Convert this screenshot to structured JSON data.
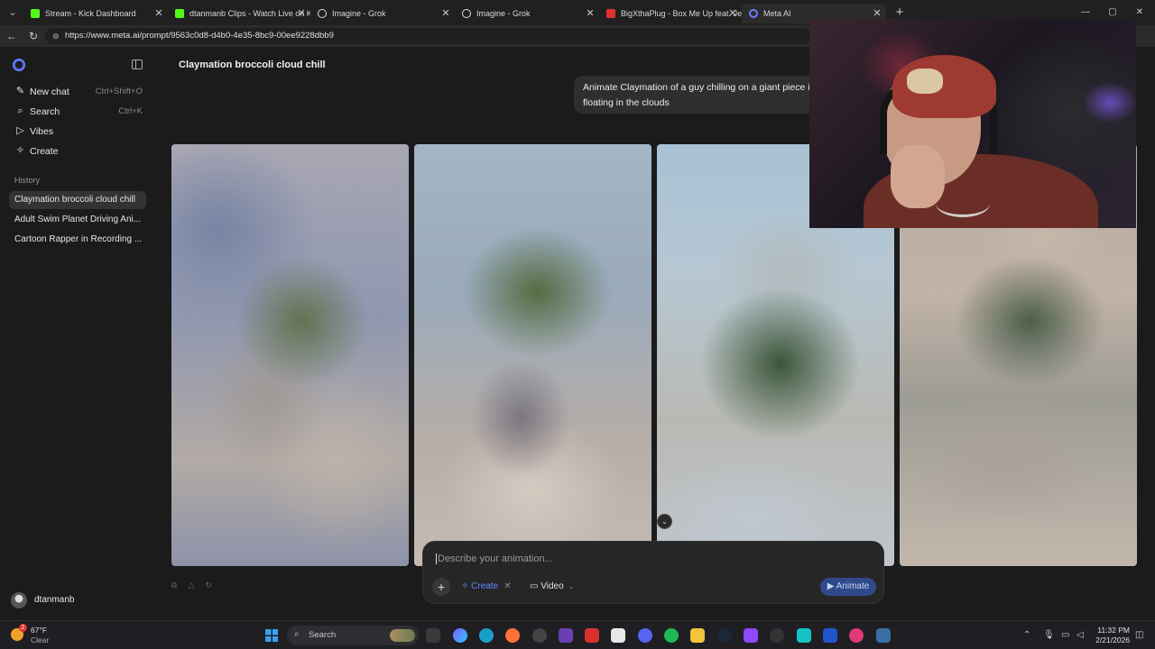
{
  "browser": {
    "tabs": [
      {
        "label": "Stream - Kick Dashboard",
        "icon": "kick-icon",
        "color": "#53fc18"
      },
      {
        "label": "dtanmanb Clips - Watch Live on K",
        "icon": "kick-icon",
        "color": "#53fc18"
      },
      {
        "label": "Imagine - Grok",
        "icon": "grok-icon",
        "color": "#ffffff"
      },
      {
        "label": "Imagine - Grok",
        "icon": "grok-icon",
        "color": "#ffffff"
      },
      {
        "label": "BigXthaPlug - Box Me Up feat. Jell",
        "icon": "youtube-icon",
        "color": "#e03030"
      },
      {
        "label": "Meta AI",
        "icon": "meta-ai-icon",
        "color": "#6d7cff"
      }
    ],
    "url": "https://www.meta.ai/prompt/9563c0d8-d4b0-4e35-8bc9-00ee9228dbb9"
  },
  "sidebar": {
    "nav": [
      {
        "label": "New chat",
        "shortcut": "Ctrl+Shift+O",
        "icon": "new-chat-icon"
      },
      {
        "label": "Search",
        "shortcut": "Ctrl+K",
        "icon": "search-icon"
      },
      {
        "label": "Vibes",
        "shortcut": "",
        "icon": "vibes-icon"
      },
      {
        "label": "Create",
        "shortcut": "",
        "icon": "create-icon"
      }
    ],
    "history_label": "History",
    "history": [
      "Claymation broccoli cloud chill",
      "Adult Swim Planet Driving Ani...",
      "Cartoon Rapper in Recording ..."
    ],
    "user": "dtanmanb"
  },
  "main": {
    "title": "Claymation broccoli cloud chill",
    "prompt": "Animate Claymation of a guy chilling on a giant piece if floating in the clouds",
    "composer": {
      "placeholder": "Describe your animation...",
      "create_label": "Create",
      "video_label": "Video",
      "animate_label": "Animate"
    }
  },
  "taskbar": {
    "weather_temp": "67°F",
    "weather_cond": "Clear",
    "weather_badge": "2",
    "search_label": "Search",
    "time": "11:32 PM",
    "date": "2/21/2026"
  },
  "colors": {
    "accent": "#5e8dff",
    "animate_button": "#2f4a8a",
    "background": "#1b1b1b"
  }
}
